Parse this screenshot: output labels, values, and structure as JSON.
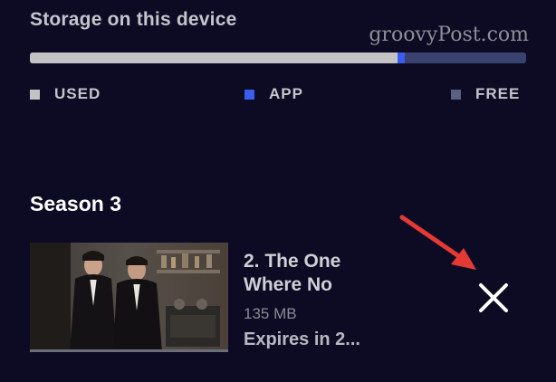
{
  "watermark": "groovyPost.com",
  "storage": {
    "title": "Storage on this device",
    "used_fraction": 0.74,
    "app_fraction": 0.015,
    "colors": {
      "used": "#c3c3c6",
      "app": "#3a5cf0",
      "free": "#3a4370"
    },
    "legend": {
      "used_label": "USED",
      "app_label": "APP",
      "free_label": "FREE"
    }
  },
  "season": {
    "title": "Season 3",
    "episode": {
      "title": "2. The One Where No",
      "size": "135 MB",
      "expires": "Expires in 2...",
      "delete_icon": "close-icon"
    }
  },
  "annotation": {
    "arrow_color": "#e53935"
  }
}
